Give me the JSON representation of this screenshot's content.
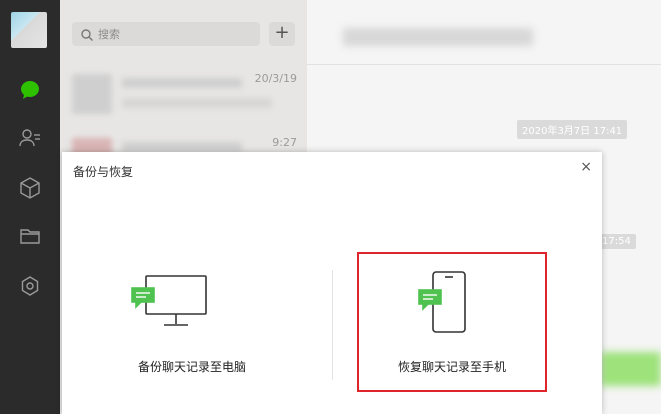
{
  "sidebar": {
    "icons": [
      "chat-icon",
      "contacts-icon",
      "favorites-box-icon",
      "folder-icon",
      "miniprogram-icon"
    ],
    "active_color": "#2dc100"
  },
  "chat_list": {
    "search_placeholder": "搜索",
    "add_button": "+",
    "rows": [
      {
        "time": "20/3/19"
      },
      {
        "time": "9:27"
      }
    ]
  },
  "chat": {
    "timestamps": [
      "2020年3月7日 17:41",
      "17:54"
    ]
  },
  "dialog": {
    "title": "备份与恢复",
    "close": "×",
    "options": [
      {
        "label": "备份聊天记录至电脑"
      },
      {
        "label": "恢复聊天记录至手机"
      }
    ],
    "highlight_color": "#e0242c"
  }
}
